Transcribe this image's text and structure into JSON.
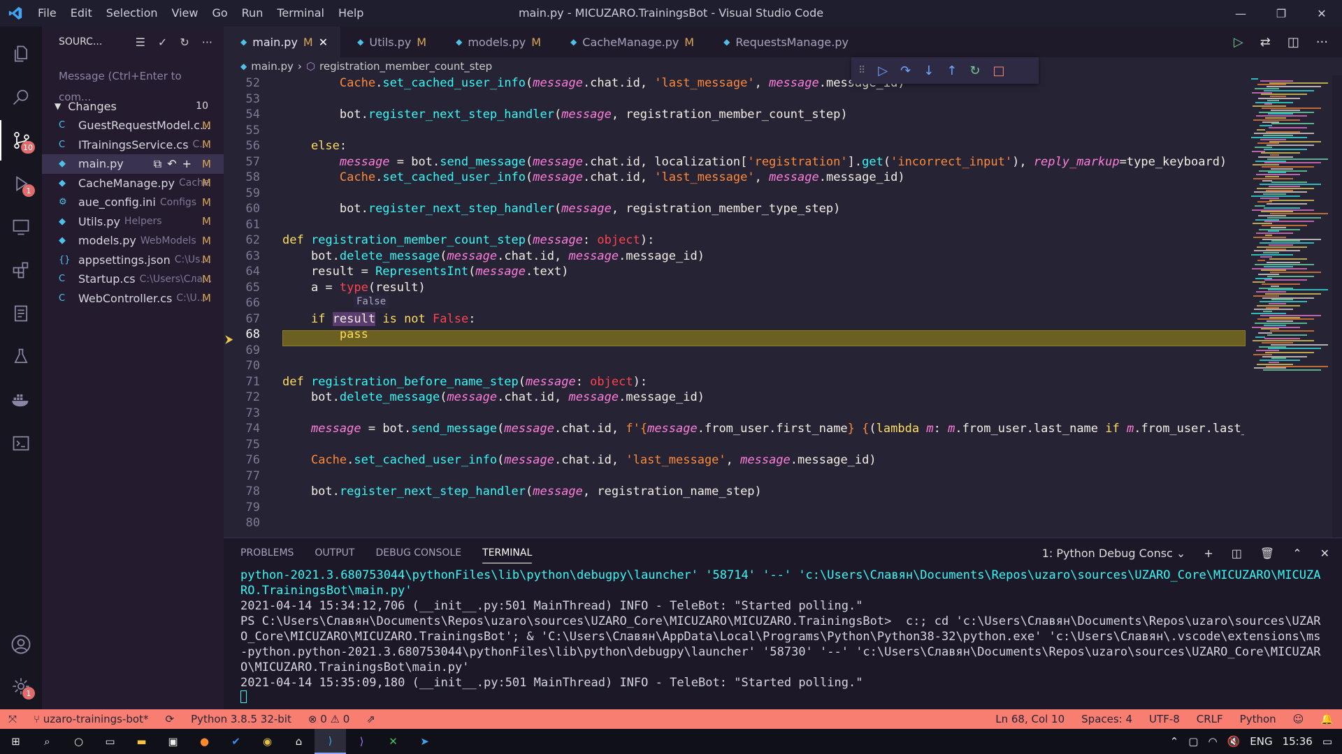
{
  "window": {
    "title": "main.py - MICUZARO.TrainingsBot - Visual Studio Code",
    "menu": [
      "File",
      "Edit",
      "Selection",
      "View",
      "Go",
      "Run",
      "Terminal",
      "Help"
    ]
  },
  "activity": {
    "scm_badge": "10",
    "debug_badge": "1",
    "settings_badge": "1"
  },
  "sidebar": {
    "title": "SOURC...",
    "message_placeholder": "Message (Ctrl+Enter to com...",
    "changes_label": "Changes",
    "changes_count": "10",
    "files": [
      {
        "icon": "C",
        "name": "GuestRequestModel.c...",
        "path": "",
        "status": "M"
      },
      {
        "icon": "C",
        "name": "ITrainingsService.cs",
        "path": "C...",
        "status": "M"
      },
      {
        "icon": "◆",
        "name": "main.py",
        "path": "",
        "status": "M"
      },
      {
        "icon": "◆",
        "name": "CacheManage.py",
        "path": "Cache",
        "status": "M"
      },
      {
        "icon": "⚙",
        "name": "aue_config.ini",
        "path": "Configs",
        "status": "M"
      },
      {
        "icon": "◆",
        "name": "Utils.py",
        "path": "Helpers",
        "status": "M"
      },
      {
        "icon": "◆",
        "name": "models.py",
        "path": "WebModels",
        "status": "M"
      },
      {
        "icon": "{}",
        "name": "appsettings.json",
        "path": "C:\\Us...",
        "status": "M"
      },
      {
        "icon": "C",
        "name": "Startup.cs",
        "path": "C:\\Users\\Сла...",
        "status": "M"
      },
      {
        "icon": "C",
        "name": "WebController.cs",
        "path": "C:\\U...",
        "status": "M"
      }
    ]
  },
  "tabs": [
    {
      "label": "main.py",
      "mod": "M"
    },
    {
      "label": "Utils.py",
      "mod": "M"
    },
    {
      "label": "models.py",
      "mod": "M"
    },
    {
      "label": "CacheManage.py",
      "mod": "M"
    },
    {
      "label": "RequestsManage.py",
      "mod": ""
    }
  ],
  "breadcrumb": {
    "file": "main.py",
    "symbol": "registration_member_count_step"
  },
  "hover_value": "False",
  "code": {
    "lines": [
      {
        "n": "52",
        "html": "        <span class='s'>Cache</span>.<span class='f'>set_cached_user_info</span>(<span class='p'>message</span>.chat.id, <span class='s'>'last_message'</span>, <span class='p'>message</span>.message_id)"
      },
      {
        "n": "53",
        "html": ""
      },
      {
        "n": "54",
        "html": "        bot.<span class='f'>register_next_step_handler</span>(<span class='p'>message</span>, registration_member_count_step)"
      },
      {
        "n": "55",
        "html": ""
      },
      {
        "n": "56",
        "html": "    <span class='k'>else</span>:"
      },
      {
        "n": "57",
        "html": "        <span class='p'>message</span> = bot.<span class='f'>send_message</span>(<span class='p'>message</span>.chat.id, localization[<span class='s'>'registration'</span>].<span class='f'>get</span>(<span class='s'>'incorrect_input'</span>), <span class='p'>reply_markup</span>=type_keyboard)"
      },
      {
        "n": "58",
        "html": "        <span class='s'>Cache</span>.<span class='f'>set_cached_user_info</span>(<span class='p'>message</span>.chat.id, <span class='s'>'last_message'</span>, <span class='p'>message</span>.message_id)"
      },
      {
        "n": "59",
        "html": ""
      },
      {
        "n": "60",
        "html": "        bot.<span class='f'>register_next_step_handler</span>(<span class='p'>message</span>, registration_member_type_step)"
      },
      {
        "n": "61",
        "html": ""
      },
      {
        "n": "62",
        "html": "<span class='k'>def</span> <span class='f'>registration_member_count_step</span>(<span class='p'>message</span>: <span class='r'>object</span>):"
      },
      {
        "n": "63",
        "html": "    bot.<span class='f'>delete_message</span>(<span class='p'>message</span>.chat.id, <span class='p'>message</span>.message_id)"
      },
      {
        "n": "64",
        "html": "    result = <span class='f'>RepresentsInt</span>(<span class='p'>message</span>.text)"
      },
      {
        "n": "65",
        "html": "    a = <span class='r'>type</span>(result)"
      },
      {
        "n": "66",
        "html": ""
      },
      {
        "n": "67",
        "html": "    <span class='k'>if</span> <span style='background:#5a3d6e'>result</span> <span class='k'>is not</span> <span class='r'>False</span>:"
      },
      {
        "n": "68",
        "html": "        <span class='k'>pass</span>"
      },
      {
        "n": "69",
        "html": ""
      },
      {
        "n": "70",
        "html": ""
      },
      {
        "n": "71",
        "html": "<span class='k'>def</span> <span class='f'>registration_before_name_step</span>(<span class='p'>message</span>: <span class='r'>object</span>):"
      },
      {
        "n": "72",
        "html": "    bot.<span class='f'>delete_message</span>(<span class='p'>message</span>.chat.id, <span class='p'>message</span>.message_id)"
      },
      {
        "n": "73",
        "html": ""
      },
      {
        "n": "74",
        "html": "    <span class='p'>message</span> = bot.<span class='f'>send_message</span>(<span class='p'>message</span>.chat.id, <span class='s'>f'{</span><span class='p'>message</span>.from_user.first_name<span class='s'>}</span> <span class='s'>{</span>(<span class='k'>lambda</span> <span class='p'>m</span>: <span class='p'>m</span>.from_user.last_name <span class='k'>if</span> <span class='p'>m</span>.from_user.last_nam"
      },
      {
        "n": "75",
        "html": ""
      },
      {
        "n": "76",
        "html": "    <span class='s'>Cache</span>.<span class='f'>set_cached_user_info</span>(<span class='p'>message</span>.chat.id, <span class='s'>'last_message'</span>, <span class='p'>message</span>.message_id)"
      },
      {
        "n": "77",
        "html": ""
      },
      {
        "n": "78",
        "html": "    bot.<span class='f'>register_next_step_handler</span>(<span class='p'>message</span>, registration_name_step)"
      },
      {
        "n": "79",
        "html": ""
      },
      {
        "n": "80",
        "html": ""
      }
    ]
  },
  "panel": {
    "tabs": [
      "PROBLEMS",
      "OUTPUT",
      "DEBUG CONSOLE",
      "TERMINAL"
    ],
    "active_tab": "TERMINAL",
    "terminal_select": "1: Python Debug Consc",
    "terminal_lines": [
      {
        "cls": "c1",
        "text": "python-2021.3.680753044\\pythonFiles\\lib\\python\\debugpy\\launcher' '58714' '--' 'c:\\Users\\Славян\\Documents\\Repos\\uzaro\\sources\\UZARO_Core\\MICUZARO\\MICUZARO.TrainingsBot\\main.py'"
      },
      {
        "cls": "",
        "text": "2021-04-14 15:34:12,706 (__init__.py:501 MainThread) INFO - TeleBot: \"Started polling.\""
      },
      {
        "cls": "",
        "text": "PS C:\\Users\\Славян\\Documents\\Repos\\uzaro\\sources\\UZARO_Core\\MICUZARO\\MICUZARO.TrainingsBot>  c:; cd 'c:\\Users\\Славян\\Documents\\Repos\\uzaro\\sources\\UZARO_Core\\MICUZARO\\MICUZARO.TrainingsBot'; & 'C:\\Users\\Славян\\AppData\\Local\\Programs\\Python\\Python38-32\\python.exe' 'c:\\Users\\Славян\\.vscode\\extensions\\ms-python.python-2021.3.680753044\\pythonFiles\\lib\\python\\debugpy\\launcher' '58730' '--' 'c:\\Users\\Славян\\Documents\\Repos\\uzaro\\sources\\UZARO_Core\\MICUZARO\\MICUZARO.TrainingsBot\\main.py'"
      },
      {
        "cls": "",
        "text": "2021-04-14 15:35:09,180 (__init__.py:501 MainThread) INFO - TeleBot: \"Started polling.\""
      }
    ]
  },
  "status": {
    "branch": "uzaro-trainings-bot*",
    "python": "Python 3.8.5 32-bit",
    "problems": "⊗ 0 ⚠ 0",
    "position": "Ln 68, Col 10",
    "spaces": "Spaces: 4",
    "encoding": "UTF-8",
    "eol": "CRLF",
    "language": "Python"
  },
  "taskbar": {
    "lang": "ENG",
    "time": "15:36"
  },
  "colors": {
    "status_bg": "#f97e72",
    "editor_bg": "#262335",
    "accent": "#36f9f6"
  }
}
